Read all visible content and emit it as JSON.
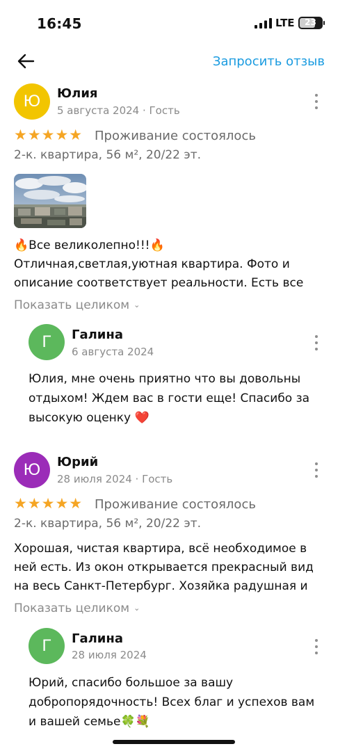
{
  "status_bar": {
    "time": "16:45",
    "network": "LTE",
    "battery": "23"
  },
  "header": {
    "back_icon": "arrow-left-icon",
    "request_review_label": "Запросить отзыв",
    "accent_color": "#1a9be0"
  },
  "reviews": [
    {
      "avatar_letter": "Ю",
      "avatar_color": "#f2c500",
      "author": "Юлия",
      "meta": "5 августа 2024 · Гость",
      "rating": "★★★★★",
      "stay_label": "Проживание состоялось",
      "apartment": "2-к. квартира, 56 м², 20/22 эт.",
      "text_lines": [
        "🔥Все великолепно!!!🔥",
        "Отличная,светлая,уютная квартира. Фото и",
        "описание соответствует реальности. Есть все"
      ],
      "show_more": "Показать целиком",
      "reply": {
        "avatar_letter": "Г",
        "avatar_color": "#5cb85c",
        "author": "Галина",
        "date": "6 августа 2024",
        "text_lines": [
          "Юлия, мне очень приятно что вы довольны",
          "отдыхом! Ждем вас в гости еще! Спасибо за",
          "высокую оценку ❤️"
        ]
      }
    },
    {
      "avatar_letter": "Ю",
      "avatar_color": "#9b2cb8",
      "author": "Юрий",
      "meta": "28 июля 2024 · Гость",
      "rating": "★★★★★",
      "stay_label": "Проживание состоялось",
      "apartment": "2-к. квартира, 56 м², 20/22 эт.",
      "text_lines": [
        "Хорошая, чистая квартира, всё необходимое в",
        "ней есть. Из окон открывается прекрасный вид",
        "на весь Санкт-Петербург. Хозяйка радушная и"
      ],
      "show_more": "Показать целиком",
      "reply": {
        "avatar_letter": "Г",
        "avatar_color": "#5cb85c",
        "author": "Галина",
        "date": "28 июля 2024",
        "text_lines": [
          "Юрий, спасибо большое за вашу",
          "добропорядочность! Всех благ и успехов вам",
          "и вашей семье🍀💐"
        ]
      }
    }
  ]
}
